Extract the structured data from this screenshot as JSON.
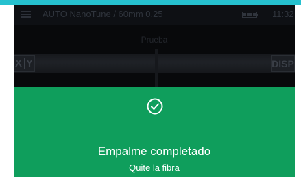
{
  "status_bar": {
    "mode": "AUTO NanoTune / 60mm 0.25",
    "time": "11:32",
    "menu_icon": "hamburger-menu-icon",
    "battery_icon": "battery-full-icon"
  },
  "camera": {
    "label": "Prueba",
    "xy_button": {
      "x": "X",
      "y": "Y"
    },
    "disp_button": "DISP"
  },
  "completion": {
    "icon": "check-circle-icon",
    "title": "Empalme completado",
    "subtitle": "Quite la fibra",
    "color": "#0f9e5c"
  },
  "colors": {
    "top_band": "#26c1cf",
    "screen_bg": "#0b0d10"
  }
}
